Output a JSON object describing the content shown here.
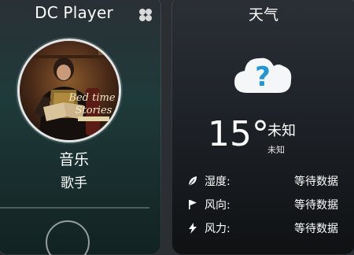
{
  "player": {
    "app_title": "DC Player",
    "menu_icon": "clover-icon",
    "song_title": "音乐",
    "artist": "歌手",
    "album_art": {
      "cover_text_line1": "Bed time",
      "cover_text_line2": "Stories"
    }
  },
  "weather": {
    "title": "天气",
    "condition_icon": "cloud-question-icon",
    "temperature": "15°",
    "condition": "未知",
    "condition_sub": "未知",
    "rows": [
      {
        "icon": "leaf-icon",
        "label": "湿度:",
        "value": "等待数据"
      },
      {
        "icon": "flag-icon",
        "label": "风向:",
        "value": "等待数据"
      },
      {
        "icon": "lightning-icon",
        "label": "风力:",
        "value": "等待数据"
      }
    ]
  },
  "colors": {
    "cloud_fill": "#f4f6f8",
    "question_mark": "#2196d3"
  }
}
